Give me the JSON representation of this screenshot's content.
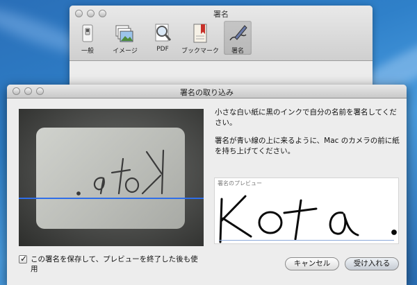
{
  "prefs_window": {
    "title": "署名",
    "toolbar": [
      {
        "label": "一般",
        "icon": "general-switch-icon"
      },
      {
        "label": "イメージ",
        "icon": "image-icon"
      },
      {
        "label": "PDF",
        "icon": "pdf-magnifier-icon"
      },
      {
        "label": "ブックマーク",
        "icon": "bookmark-icon"
      },
      {
        "label": "署名",
        "icon": "signature-pen-icon"
      }
    ]
  },
  "dialog": {
    "title": "署名の取り込み",
    "instruction_1": "小さな白い紙に黒のインクで自分の名前を署名してください。",
    "instruction_2": "署名が青い線の上に来るように、Mac のカメラの前に紙を持ち上げてください。",
    "preview_label": "署名のプレビュー",
    "save_checkbox_label": "この署名を保存して、プレビューを終了した後も使用",
    "save_checked": true,
    "cancel_label": "キャンセル",
    "accept_label": "受け入れる",
    "colors": {
      "guide_line": "#2f6ee8",
      "accent": "#2a6fb8"
    }
  }
}
